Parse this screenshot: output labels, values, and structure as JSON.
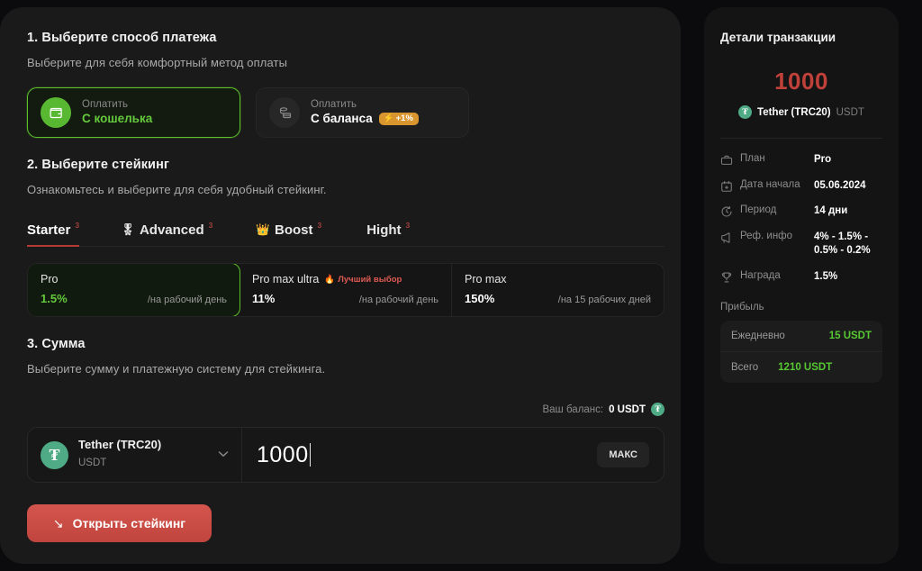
{
  "steps": {
    "payment": {
      "title": "1. Выберите способ платежа",
      "subtitle": "Выберите для себя комфортный метод оплаты",
      "methods": [
        {
          "top": "Оплатить",
          "bottom": "С кошелька",
          "icon": "wallet-icon",
          "selected": true,
          "badge": null
        },
        {
          "top": "Оплатить",
          "bottom": "С баланса",
          "icon": "coins-stack-icon",
          "selected": false,
          "badge": "+1%"
        }
      ]
    },
    "staking": {
      "title": "2. Выберите стейкинг",
      "subtitle": "Ознакомьтесь и выберите для себя удобный стейкинг.",
      "tabs": [
        {
          "label": "Starter",
          "emoji": "",
          "count": "3",
          "active": true
        },
        {
          "label": "Advanced",
          "emoji": "🎖",
          "count": "3",
          "active": false
        },
        {
          "label": "Boost",
          "emoji": "👑",
          "count": "3",
          "active": false
        },
        {
          "label": "Hight",
          "emoji": "",
          "count": "3",
          "active": false
        }
      ],
      "plans": [
        {
          "name": "Pro",
          "rate": "1.5%",
          "period": "/на рабочий день",
          "selected": true,
          "badge": null
        },
        {
          "name": "Pro max ultra",
          "rate": "11%",
          "period": "/на рабочий день",
          "selected": false,
          "badge": "Лучший выбор"
        },
        {
          "name": "Pro max",
          "rate": "150%",
          "period": "/на 15 рабочих дней",
          "selected": false,
          "badge": null
        }
      ]
    },
    "amount": {
      "title": "3. Сумма",
      "subtitle": "Выберите сумму и платежную систему для стейкинга.",
      "balance_label": "Ваш баланс:",
      "balance_value": "0 USDT",
      "coin_name": "Tether (TRC20)",
      "coin_symbol": "USDT",
      "coin_glyph": "₮",
      "input_value": "1000",
      "input_placeholder": "0",
      "max_label": "МАКС"
    }
  },
  "cta": {
    "label": "Открыть стейкинг",
    "arrow": "↘"
  },
  "transaction": {
    "title": "Детали транзакции",
    "amount": "1000",
    "coin_name": "Tether (TRC20)",
    "coin_symbol": "USDT",
    "coin_glyph": "₮",
    "rows": [
      {
        "icon": "briefcase-icon",
        "label": "План",
        "value": "Pro"
      },
      {
        "icon": "calendar-icon",
        "label": "Дата начала",
        "value": "05.06.2024"
      },
      {
        "icon": "clock-icon",
        "label": "Период",
        "value": "14 дни"
      },
      {
        "icon": "megaphone-icon",
        "label": "Реф. инфо",
        "value": "4% - 1.5% - 0.5% - 0.2%"
      },
      {
        "icon": "trophy-icon",
        "label": "Награда",
        "value": "1.5%"
      }
    ],
    "profit_label": "Прибыль",
    "profit": [
      {
        "key": "Ежедневно",
        "value": "15 USDT"
      },
      {
        "key": "Всего",
        "value": "1210 USDT"
      }
    ]
  },
  "colors": {
    "accent_green": "#64c93c",
    "accent_red": "#c0403a",
    "badge_orange": "#d9962f",
    "usdt_teal": "#4fab85",
    "panel_left": "#1a1a1a",
    "panel_right": "#141414",
    "page_bg": "#0b0b0d"
  }
}
